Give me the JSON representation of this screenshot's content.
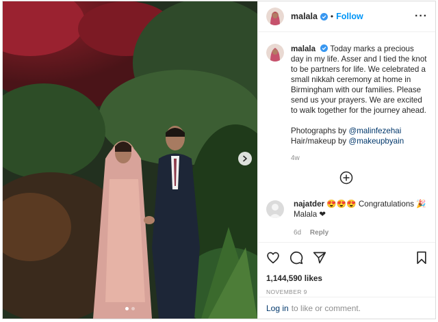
{
  "post": {
    "username": "malala",
    "follow_label": "Follow",
    "separator": "•",
    "more_label": "···"
  },
  "caption": {
    "username": "malala",
    "text": "Today marks a precious day in my life. Asser and I tied the knot to be partners for life. We celebrated a small nikkah ceremony at home in Birmingham with our families. Please send us your prayers. We are excited to walk together for the journey ahead.",
    "photos_prefix": "Photographs by ",
    "photos_handle": "@malinfezehai",
    "hair_prefix": "Hair/makeup by ",
    "hair_handle": "@makeupbyain",
    "age": "4w"
  },
  "comment": {
    "username": "najatder",
    "text": "😍😍😍 Congratulations 🎉 Malala ❤",
    "age": "6d",
    "reply_label": "Reply"
  },
  "stats": {
    "likes": "1,144,590 likes",
    "date": "NOVEMBER 9"
  },
  "login": {
    "link": "Log in",
    "rest": "to like or comment."
  },
  "icons": {
    "verified": "verified-badge-icon",
    "like": "heart-icon",
    "comment": "comment-bubble-icon",
    "share": "paper-plane-icon",
    "save": "bookmark-icon",
    "load_more": "plus-circle-icon",
    "next": "chevron-right-icon"
  },
  "carousel": {
    "count": 2,
    "active_index": 0
  },
  "colors": {
    "accent": "#0095f6",
    "link": "#00376b",
    "muted": "#8e8e8e",
    "border": "#dbdbdb"
  }
}
